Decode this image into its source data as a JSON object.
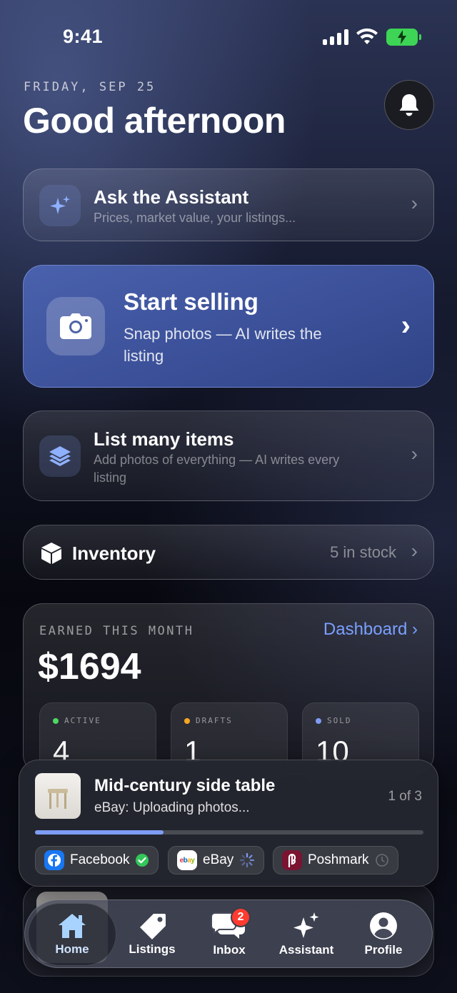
{
  "status_bar": {
    "time": "9:41"
  },
  "header": {
    "date": "FRIDAY, SEP 25",
    "greeting": "Good afternoon"
  },
  "assistant_card": {
    "title": "Ask the Assistant",
    "subtitle": "Prices, market value, your listings..."
  },
  "start_selling": {
    "title": "Start selling",
    "subtitle": "Snap photos — AI writes the listing"
  },
  "list_many": {
    "title": "List many items",
    "subtitle": "Add photos of everything — AI writes every listing"
  },
  "inventory": {
    "title": "Inventory",
    "stock": "5 in stock"
  },
  "earnings": {
    "label": "EARNED THIS MONTH",
    "dashboard_link": "Dashboard",
    "amount": "$1694",
    "stats": [
      {
        "label": "ACTIVE",
        "value": "4",
        "color": "#4cd964"
      },
      {
        "label": "DRAFTS",
        "value": "1",
        "color": "#f5a623"
      },
      {
        "label": "SOLD",
        "value": "10",
        "color": "#7f9cf5"
      }
    ]
  },
  "upload": {
    "title": "Mid-century side table",
    "status": "eBay: Uploading photos...",
    "count": "1 of 3",
    "progress": 0.33,
    "channels": [
      {
        "name": "Facebook",
        "state": "done",
        "color": "#1877f2"
      },
      {
        "name": "eBay",
        "state": "uploading",
        "color": "#ffffff"
      },
      {
        "name": "Poshmark",
        "state": "pending",
        "color": "#7a1430"
      }
    ]
  },
  "nav": {
    "items": [
      {
        "label": "Home",
        "icon": "home-icon"
      },
      {
        "label": "Listings",
        "icon": "tag-icon"
      },
      {
        "label": "Inbox",
        "icon": "chat-icon",
        "badge": "2"
      },
      {
        "label": "Assistant",
        "icon": "sparkle-icon"
      },
      {
        "label": "Profile",
        "icon": "person-icon"
      }
    ]
  },
  "colors": {
    "accent": "#7aa0ff",
    "sell_card": "#4a61ad",
    "badge": "#ff3b30"
  }
}
